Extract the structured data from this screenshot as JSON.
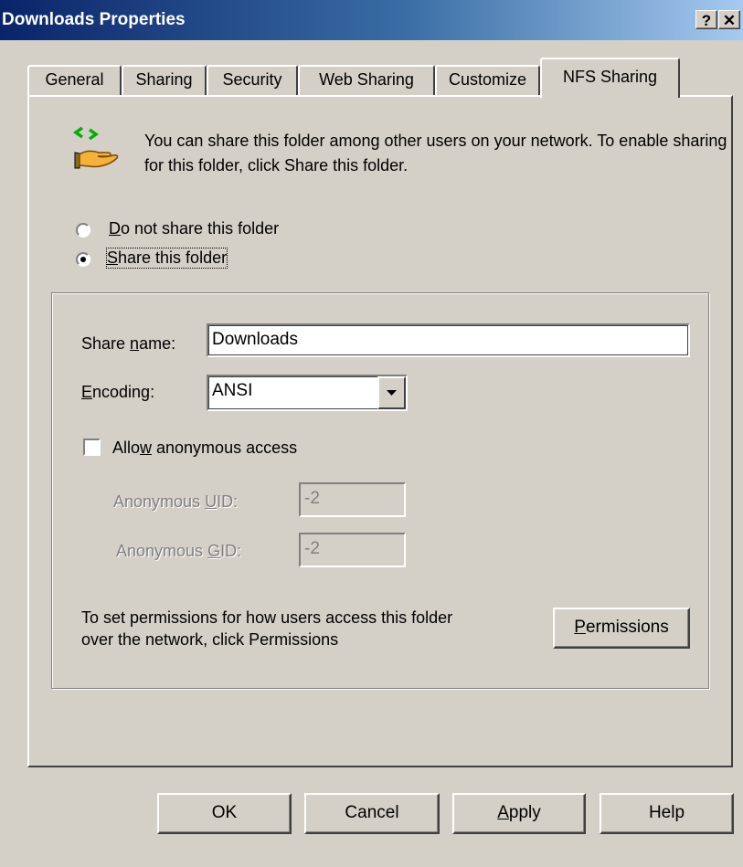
{
  "window": {
    "title": "Downloads Properties",
    "help_glyph": "?",
    "close_glyph": "✕"
  },
  "tabs": [
    {
      "label": "General"
    },
    {
      "label": "Sharing"
    },
    {
      "label": "Security"
    },
    {
      "label": "Web Sharing"
    },
    {
      "label": "Customize"
    },
    {
      "label": "NFS Sharing",
      "active": true
    }
  ],
  "intro": {
    "icon": "shared-folder-hand-icon",
    "text": "You can share this folder among other users on your network. To enable sharing for this folder, click Share this folder."
  },
  "sharing_options": {
    "do_not_share": {
      "mnemonic": "D",
      "rest": "o not share this folder",
      "selected": false
    },
    "share": {
      "mnemonic": "S",
      "rest": "hare this folder",
      "selected": true
    }
  },
  "share_settings": {
    "share_name": {
      "pre": "Share ",
      "mnemonic": "n",
      "post": "ame:",
      "value": "Downloads"
    },
    "encoding": {
      "mnemonic": "E",
      "post": "ncoding:",
      "value": "ANSI"
    },
    "anonymous": {
      "pre": "Allo",
      "mnemonic": "w",
      "post": " anonymous access",
      "checked": false
    },
    "uid": {
      "pre": "Anonymous ",
      "mnemonic": "U",
      "post": "ID:",
      "value": "-2"
    },
    "gid": {
      "pre": "Anonymous ",
      "mnemonic": "G",
      "post": "ID:",
      "value": "-2"
    },
    "permissions_note_line1": "To set permissions for how users access this folder",
    "permissions_note_line2": "over the network, click Permissions",
    "permissions_button": {
      "mnemonic": "P",
      "rest": "ermissions"
    }
  },
  "footer": {
    "ok": "OK",
    "cancel": "Cancel",
    "apply": {
      "mnemonic": "A",
      "rest": "pply"
    },
    "help": "Help"
  },
  "colors": {
    "title_start": "#0a246a",
    "title_end": "#a6caf0",
    "face": "#d4d0c8",
    "icon_arrow": "#00b000"
  }
}
